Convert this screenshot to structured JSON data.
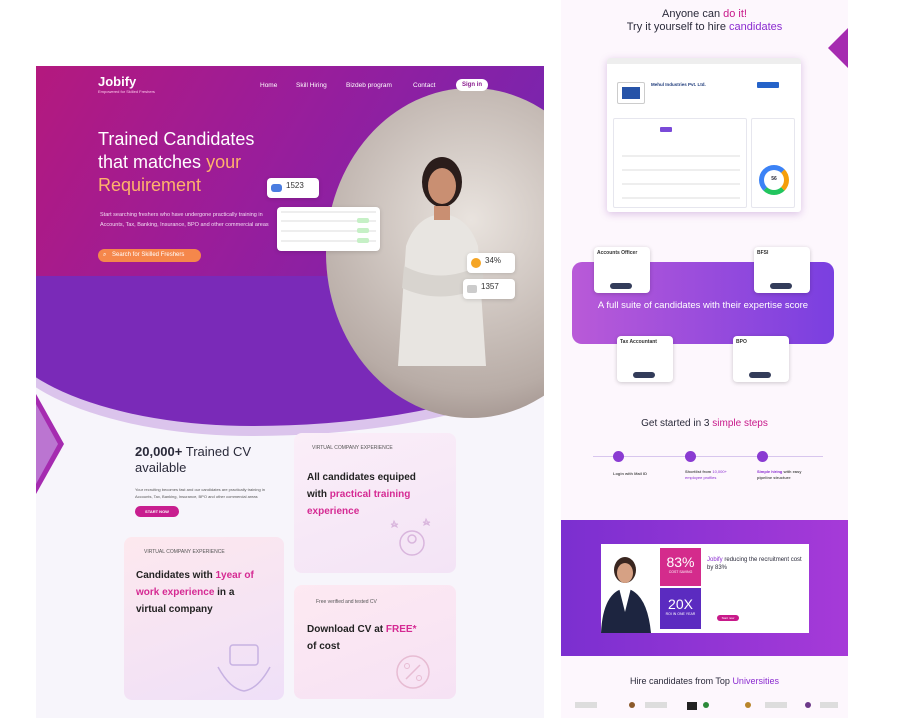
{
  "left": {
    "brand": {
      "name": "Jobify",
      "tagline": "Empowered for Skilled Freshers"
    },
    "nav": [
      "Home",
      "Skill Hiring",
      "Bizdeb program",
      "Contact"
    ],
    "signin": "Sign in",
    "hero": {
      "title_line1": "Trained Candidates",
      "title_line2a": "that matches ",
      "title_line2b": "your",
      "title_line3": "Requirement",
      "subtitle": "Start searching freshers who have undergone practically training in Accounts, Tax, Banking, Insurance, BPO and other commercial areas",
      "search_button": "Search for Skilled Freshers",
      "stat1_value": "1523",
      "stat2_value": "34%",
      "stat3_value": "1357"
    },
    "features": {
      "count": "20,000+",
      "count_rest": " Trained CV",
      "count_line2": "available",
      "subtitle": "Your recruiting becomes fast and our candidates are practically training in Accounts, Tax, Banking, Insurance, BPO and other commercial areas",
      "start_button": "START NOW",
      "card1_tag": "VIRTUAL COMPANY EXPERIENCE",
      "card1_a": "All candidates equiped",
      "card1_b": "with ",
      "card1_c": "practical training",
      "card1_d": "experience",
      "card2_tag": "VIRTUAL COMPANY EXPERIENCE",
      "card2_a": "Candidates with ",
      "card2_b": "1year of",
      "card2_c": "work experience",
      "card2_d": " in a",
      "card2_e": "virtual company",
      "card3_tag": "Free verified and tested CV",
      "card3_a": "Download CV at ",
      "card3_b": "FREE*",
      "card3_c": "of cost"
    }
  },
  "right": {
    "headline_a": "Anyone can ",
    "headline_b": "do it!",
    "headline_c": "Try it yourself to hire ",
    "headline_d": "candidates",
    "company": "Mehul Industries Pvt. Ltd.",
    "donut_value": "56",
    "band_text": "A full suite of candidates with their expertise score",
    "mini_cards": [
      {
        "title": "Accounts Officer"
      },
      {
        "title": "BFSI"
      },
      {
        "title": "Tax Accountant"
      },
      {
        "title": "BPO"
      }
    ],
    "steps_title_a": "Get started in 3 ",
    "steps_title_b": "simple steps",
    "steps": [
      {
        "a": "Login with Mail ID",
        "b": ""
      },
      {
        "a": "Shortlist from ",
        "b": "10,000+ employee profiles"
      },
      {
        "a": "Simple hiring",
        "b": " with easy pipeline structure"
      }
    ],
    "promo": {
      "stat1": "83%",
      "stat1_label": "COST SAVING",
      "stat2": "20X",
      "stat2_label": "ROI IN ONE YEAR",
      "brand": "Jobify",
      "text": " reducing the recruitment cost by 83%",
      "button": "Start now"
    },
    "universities_a": "Hire candidates from Top ",
    "universities_b": "Universities"
  }
}
